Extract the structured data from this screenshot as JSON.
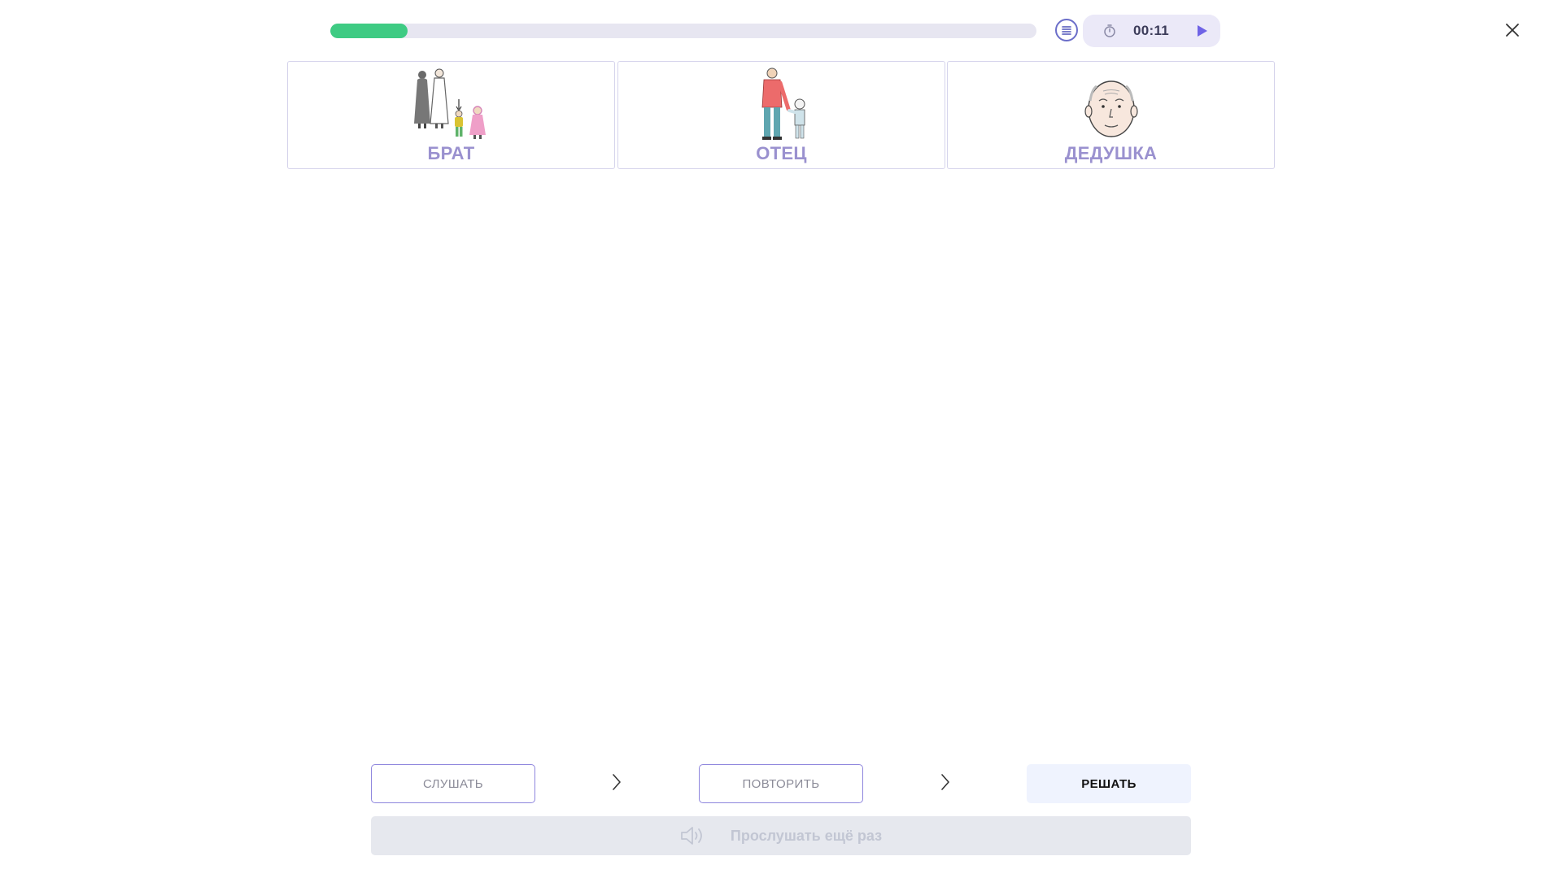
{
  "progress": {
    "value_percent": 11,
    "color": "#3ecb83"
  },
  "timer": {
    "time": "00:11"
  },
  "cards": [
    {
      "label": "БРАТ",
      "image": "family-pictogram"
    },
    {
      "label": "ОТЕЦ",
      "image": "father-with-child-pictogram"
    },
    {
      "label": "ДЕДУШКА",
      "image": "grandfather-face-pictogram"
    }
  ],
  "steps": {
    "listen_label": "СЛУШАТЬ",
    "repeat_label": "ПОВТОРИТЬ",
    "solve_label": "РЕШАТЬ"
  },
  "replay": {
    "label": "Прослушать ещё раз",
    "icon": "speaker-icon"
  },
  "colors": {
    "accent": "#8e85dd",
    "card_label": "#9a91cf",
    "timer_bg": "#ebe9f8"
  }
}
